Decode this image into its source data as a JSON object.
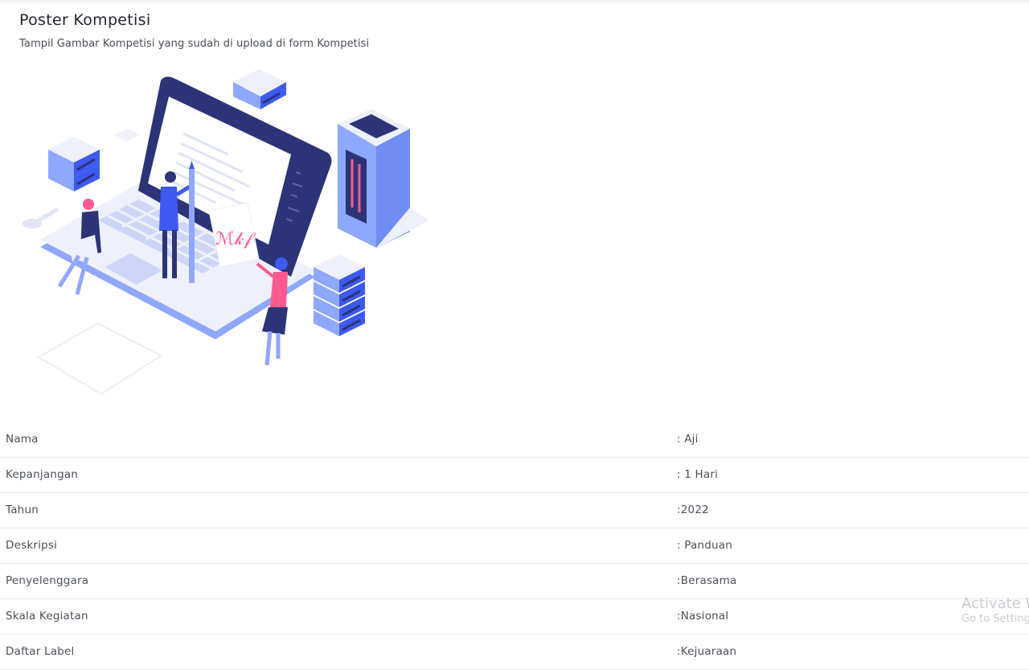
{
  "card": {
    "title": "Poster Kompetisi",
    "subtitle": "Tampil Gambar Kompetisi yang sudah di upload di form Kompetisi"
  },
  "poster": {
    "signature": "ℳ𝓀𝒻"
  },
  "details": [
    {
      "label": "Nama",
      "value": ": Aji"
    },
    {
      "label": "Kepanjangan",
      "value": ": 1 Hari"
    },
    {
      "label": "Tahun",
      "value": ":2022"
    },
    {
      "label": "Deskripsi",
      "value": ": Panduan"
    },
    {
      "label": "Penyelenggara",
      "value": ":Berasama"
    },
    {
      "label": "Skala Kegiatan",
      "value": ":Nasional"
    },
    {
      "label": "Daftar Label",
      "value": ":Kejuaraan"
    }
  ],
  "watermark": {
    "line1": "Activate Windows",
    "line2": "Go to Settings to activate Windows."
  },
  "colors": {
    "navy": "#2c3477",
    "blue": "#3d5af1",
    "light_blue": "#8ea7ff",
    "pink": "#ff5a8f",
    "pale": "#eef0fb"
  }
}
